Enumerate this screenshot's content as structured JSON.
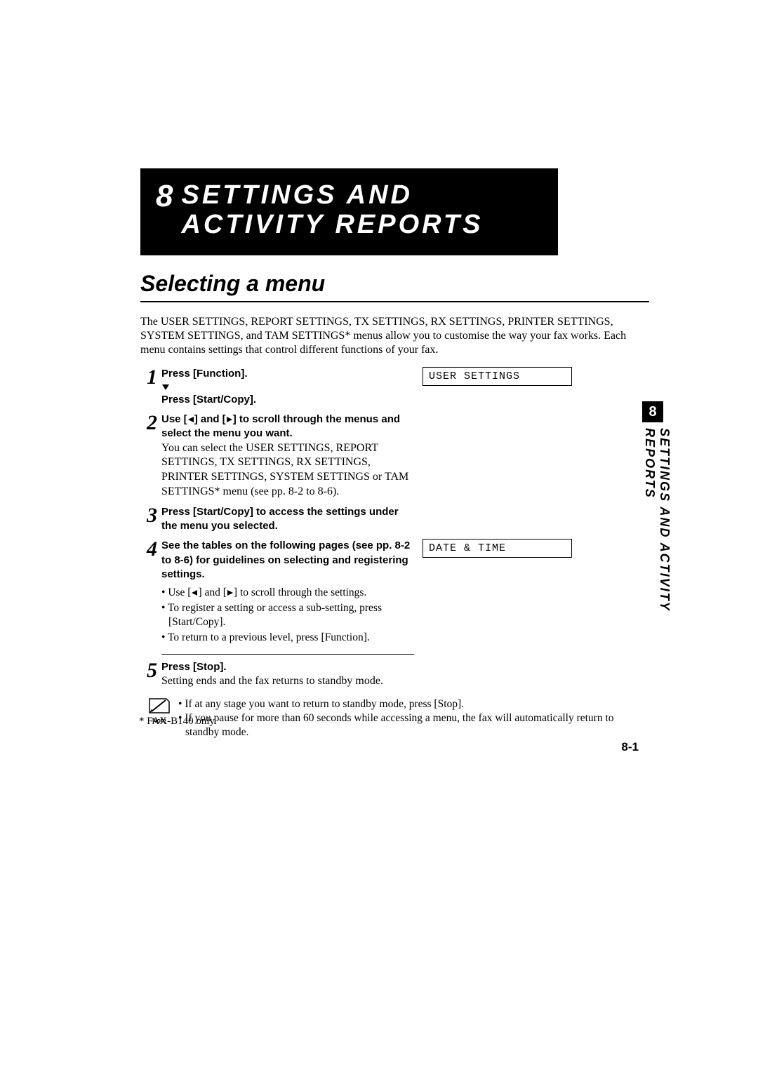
{
  "chapter": {
    "number": "8",
    "title_line1": "SETTINGS AND",
    "title_line2": "ACTIVITY REPORTS"
  },
  "section_title": "Selecting a menu",
  "intro": "The USER SETTINGS, REPORT SETTINGS, TX SETTINGS, RX SETTINGS, PRINTER SETTINGS, SYSTEM SETTINGS, and TAM SETTINGS* menus allow you to customise the way your fax works. Each menu contains settings that control different functions of your fax.",
  "steps": {
    "s1": {
      "num": "1",
      "line1": "Press [Function].",
      "line2_prefix": "",
      "line3": "Press [Start/Copy].",
      "lcd": "USER SETTINGS"
    },
    "s2": {
      "num": "2",
      "bold_a": "Use [",
      "bold_b": "] and [",
      "bold_c": "] to scroll through the menus and select the menu you want.",
      "plain": "You can select the USER SETTINGS, REPORT SETTINGS, TX SETTINGS, RX SETTINGS, PRINTER SETTINGS, SYSTEM SETTINGS or TAM SETTINGS* menu (see pp. 8-2 to 8-6)."
    },
    "s3": {
      "num": "3",
      "bold": "Press [Start/Copy] to access the settings under the menu you selected."
    },
    "s4": {
      "num": "4",
      "bold": "See the tables on the following pages (see pp. 8-2 to 8-6) for guidelines on selecting and registering settings.",
      "lcd": "DATE & TIME",
      "b1a": "Use [",
      "b1b": "] and [",
      "b1c": "] to scroll through the settings.",
      "b2": "To register a setting or access a sub-setting, press [Start/Copy].",
      "b3": "To return to a previous level, press [Function]."
    },
    "s5": {
      "num": "5",
      "bold": "Press [Stop].",
      "plain": "Setting ends and the fax returns to standby mode."
    }
  },
  "note": {
    "label": "Note",
    "b1": "If at any stage you want to return to standby mode, press [Stop].",
    "b2": "If you pause for more than 60 seconds while accessing a menu, the fax will automatically return to standby mode."
  },
  "side_tab": {
    "num": "8",
    "label": "SETTINGS AND ACTIVITY REPORTS"
  },
  "footnote": "* FAX-B140 only.",
  "page_number": "8-1"
}
